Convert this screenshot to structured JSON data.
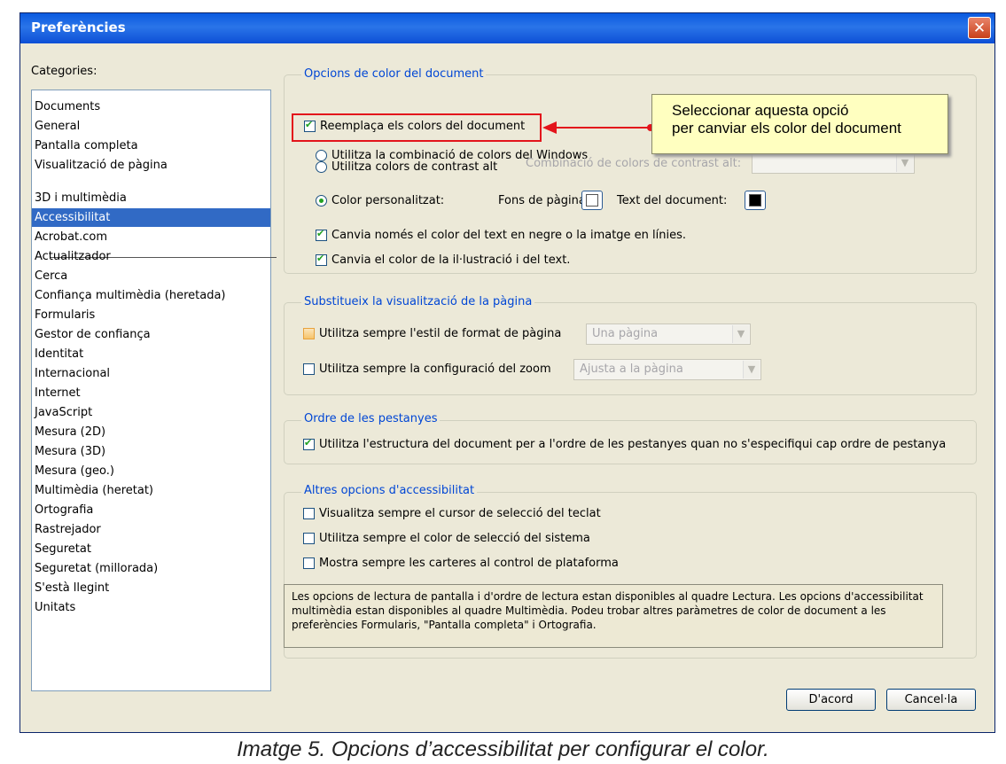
{
  "window": {
    "title": "Preferències",
    "close_glyph": "✕"
  },
  "categories": {
    "label": "Categories:",
    "top_items": [
      "Documents",
      "General",
      "Pantalla completa",
      "Visualització de pàgina"
    ],
    "items": [
      "3D i multimèdia",
      "Accessibilitat",
      "Acrobat.com",
      "Actualitzador",
      "Cerca",
      "Confiança multimèdia (heretada)",
      "Formularis",
      "Gestor de confiança",
      "Identitat",
      "Internacional",
      "Internet",
      "JavaScript",
      "Mesura (2D)",
      "Mesura (3D)",
      "Mesura (geo.)",
      "Multimèdia (heretat)",
      "Ortografia",
      "Rastrejador",
      "Seguretat",
      "Seguretat (millorada)",
      "S'està llegint",
      "Unitats"
    ],
    "selected": "Accessibilitat"
  },
  "color_options": {
    "legend": "Opcions de color del document",
    "replace_colors": "Reemplaça els colors del document",
    "windows_scheme": "Utilitza la combinació de colors del Windows",
    "high_contrast": "Utilitza colors de contrast alt",
    "high_contrast_combo_label": "Combinació de colors de contrast alt:",
    "custom_color": "Color personalitzat:",
    "page_background": "Fons de pàgina:",
    "document_text": "Text del document:",
    "page_background_color": "#ffffff",
    "document_text_color": "#000000",
    "change_black_only": "Canvia només el color del text en negre o la imatge en línies.",
    "change_art_and_text": "Canvia el color de la il·lustració i del text."
  },
  "page_display": {
    "legend": "Substitueix la visualització de la pàgina",
    "always_layout": "Utilitza sempre l'estil de format de pàgina",
    "layout_value": "Una pàgina",
    "always_zoom": "Utilitza sempre la configuració del zoom",
    "zoom_value": "Ajusta a la pàgina"
  },
  "tab_order": {
    "legend": "Ordre de les pestanyes",
    "use_structure": "Utilitza l'estructura del document per a l'ordre de les pestanyes quan no s'especifiqui cap ordre de pestanya"
  },
  "other": {
    "legend": "Altres opcions d'accessibilitat",
    "keyboard_cursor": "Visualitza sempre el cursor de selecció del teclat",
    "system_selection_color": "Utilitza sempre el color de selecció del sistema",
    "show_portfolios": "Mostra sempre les carteres al control de plataforma",
    "info_text": "Les opcions de lectura de pantalla i d'ordre de lectura estan disponibles al quadre Lectura. Les opcions d'accessibilitat multimèdia estan disponibles al quadre Multimèdia. Podeu trobar altres paràmetres de color de document a les preferències Formularis, \"Pantalla completa\" i Ortografia."
  },
  "buttons": {
    "ok": "D'acord",
    "cancel": "Cancel·la"
  },
  "annotation": {
    "line1": "Seleccionar aquesta opció",
    "line2": "per canviar els color del document",
    "highlight_color": "#e3141b"
  },
  "caption": "Imatge 5. Opcions d’accessibilitat per configurar el color.",
  "colors": {
    "titlebar": "#0a5ae0",
    "selection": "#316ac5",
    "legend_text": "#0046d5",
    "dialog_bg": "#ece9d8"
  }
}
